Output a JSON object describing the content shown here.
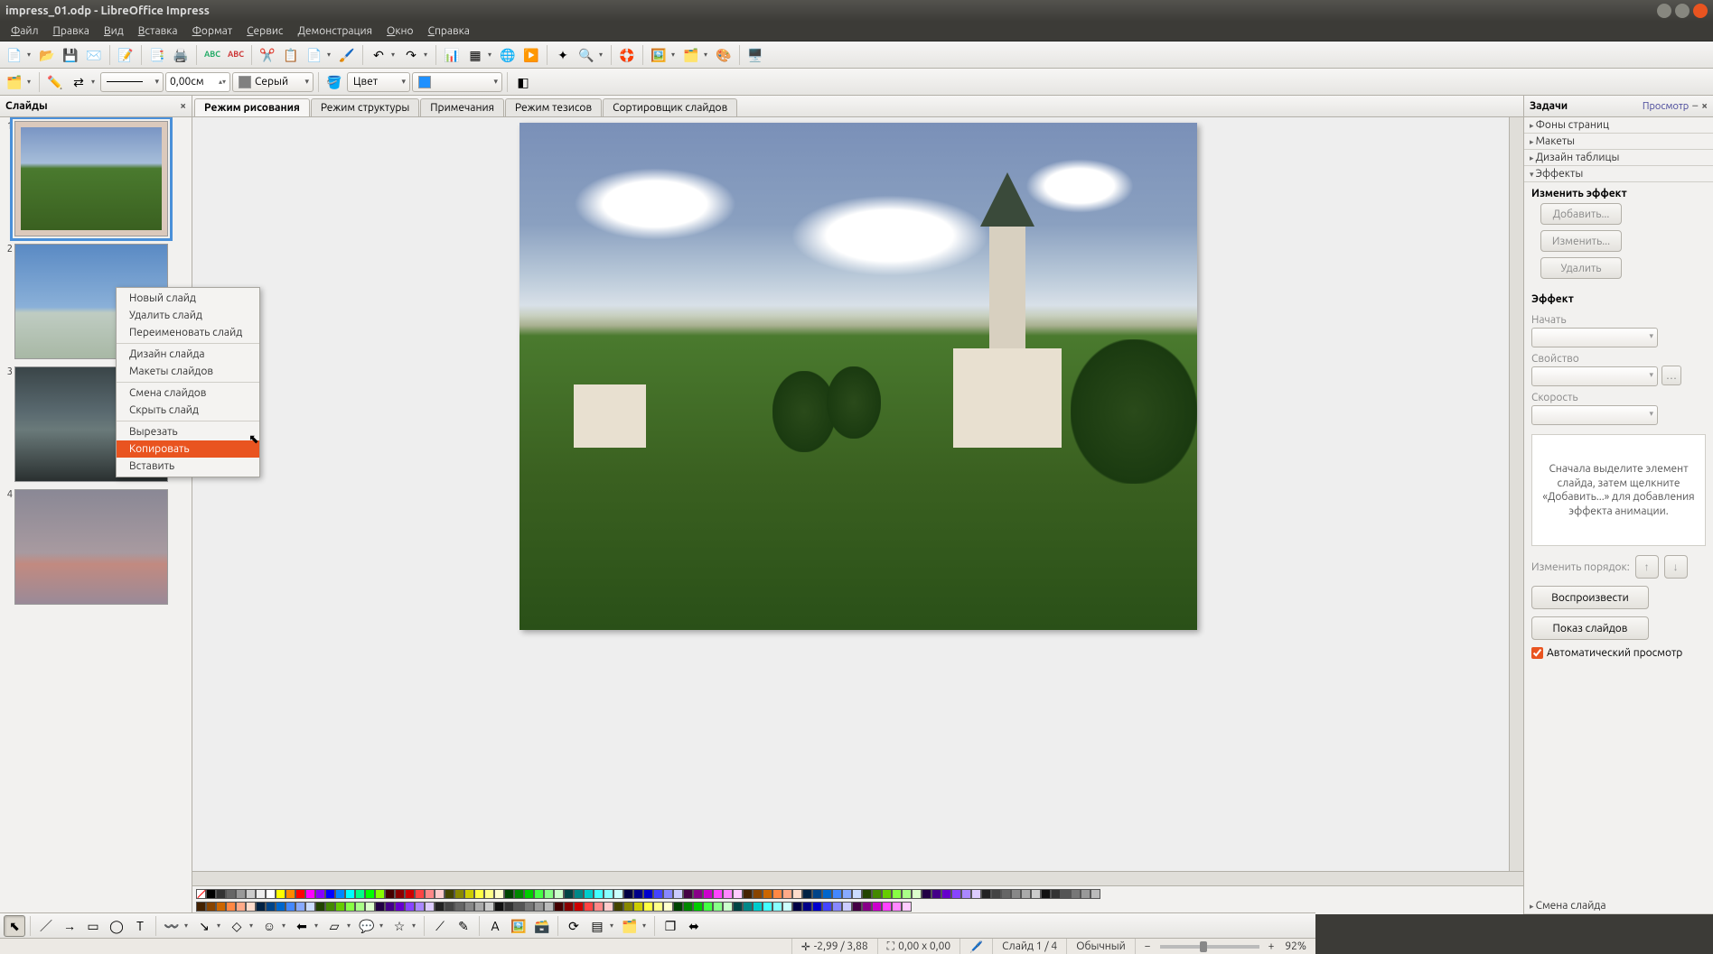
{
  "window": {
    "title": "impress_01.odp - LibreOffice Impress"
  },
  "menubar": [
    "Файл",
    "Правка",
    "Вид",
    "Вставка",
    "Формат",
    "Сервис",
    "Демонстрация",
    "Окно",
    "Справка"
  ],
  "toolbar2": {
    "line_width": "0,00см",
    "line_color_label": "Серый",
    "line_color": "#808080",
    "fill_label": "Цвет",
    "fill_swatch": "#1e90ff"
  },
  "slide_panel": {
    "title": "Слайды",
    "slides": [
      1,
      2,
      3,
      4
    ]
  },
  "tabs": [
    "Режим рисования",
    "Режим структуры",
    "Примечания",
    "Режим тезисов",
    "Сортировщик слайдов"
  ],
  "context_menu": {
    "items": [
      {
        "label": "Новый слайд",
        "enabled": true
      },
      {
        "label": "Удалить слайд",
        "enabled": true
      },
      {
        "label": "Переименовать слайд",
        "enabled": true
      },
      {
        "sep": true
      },
      {
        "label": "Дизайн слайда",
        "enabled": true
      },
      {
        "label": "Макеты слайдов",
        "enabled": true
      },
      {
        "sep": true
      },
      {
        "label": "Смена слайдов",
        "enabled": true
      },
      {
        "label": "Скрыть слайд",
        "enabled": true
      },
      {
        "sep": true
      },
      {
        "label": "Вырезать",
        "enabled": true
      },
      {
        "label": "Копировать",
        "enabled": true,
        "hover": true
      },
      {
        "label": "Вставить",
        "enabled": true
      }
    ]
  },
  "task_panel": {
    "title": "Задачи",
    "view": "Просмотр",
    "sections": [
      "Фоны страниц",
      "Макеты",
      "Дизайн таблицы",
      "Эффекты"
    ],
    "effects": {
      "change_label": "Изменить эффект",
      "add": "Добавить...",
      "modify": "Изменить...",
      "remove": "Удалить",
      "effect_label": "Эффект",
      "start_label": "Начать",
      "property_label": "Свойство",
      "speed_label": "Скорость",
      "hint": "Сначала выделите элемент слайда, затем щелкните «Добавить...» для добавления эффекта анимации.",
      "order_label": "Изменить порядок:",
      "play": "Воспроизвести",
      "show": "Показ слайдов",
      "auto": "Автоматический просмотр"
    },
    "last_section": "Смена слайда"
  },
  "statusbar": {
    "coords": "-2,99 / 3,88",
    "size": "0,00 x 0,00",
    "slide": "Слайд 1 / 4",
    "style": "Обычный",
    "zoom": "92%"
  }
}
